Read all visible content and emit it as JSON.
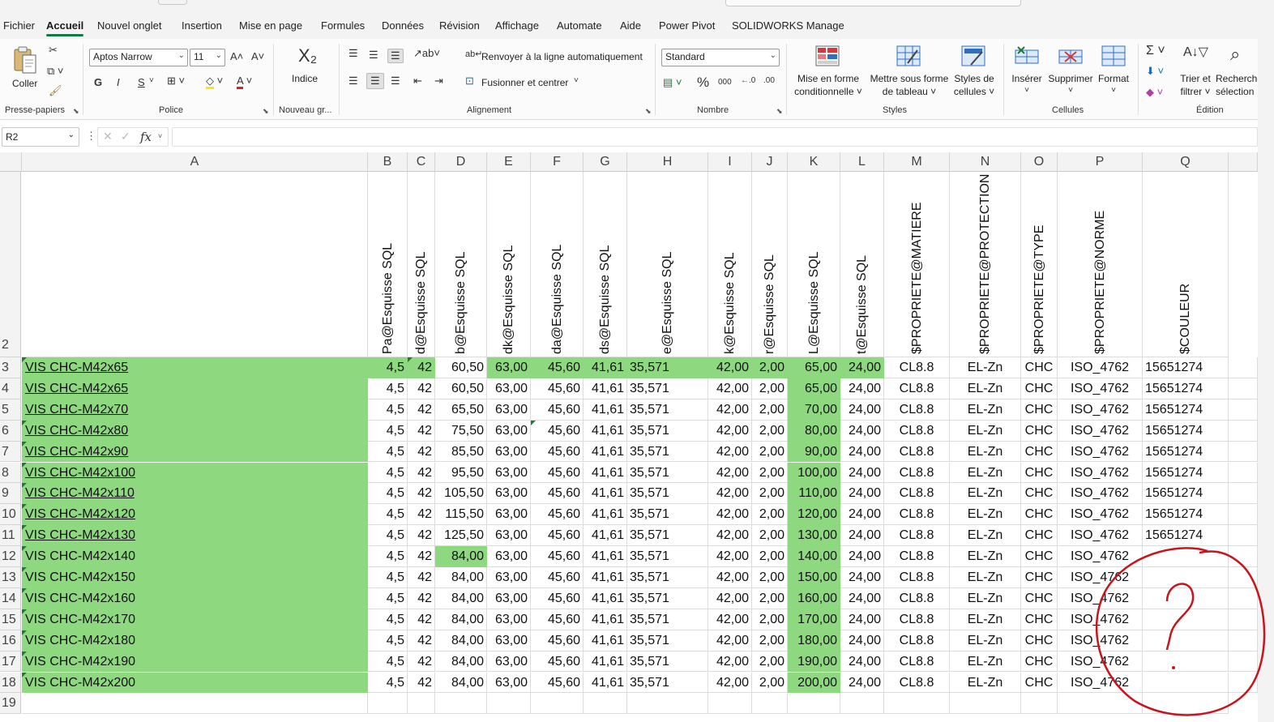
{
  "menu": {
    "tabs": [
      "Fichier",
      "Accueil",
      "Nouvel onglet",
      "Insertion",
      "Mise en page",
      "Formules",
      "Données",
      "Révision",
      "Affichage",
      "Automate",
      "Aide",
      "Power Pivot",
      "SOLIDWORKS Manage"
    ],
    "active": "Accueil"
  },
  "ribbon": {
    "clipboard": {
      "paste_label": "Coller",
      "group_label": "Presse-papiers"
    },
    "font": {
      "name": "Aptos Narrow",
      "size": "11",
      "bold": "G",
      "italic": "I",
      "underline": "S",
      "group_label": "Police"
    },
    "subscript": {
      "icon_text": "X₂",
      "label": "Indice",
      "group_label": "Nouveau gr..."
    },
    "alignment": {
      "wrap_label": "Renvoyer à la ligne automatiquement",
      "merge_label": "Fusionner et centrer",
      "group_label": "Alignement"
    },
    "number": {
      "format": "Standard",
      "percent": "%",
      "thousands": "000",
      "group_label": "Nombre"
    },
    "styles": {
      "conditional": [
        "Mise en forme",
        "conditionnelle ˅"
      ],
      "table": [
        "Mettre sous forme",
        "de tableau ˅"
      ],
      "cell_styles": [
        "Styles de",
        "cellules ˅"
      ],
      "group_label": "Styles"
    },
    "cells": {
      "insert": "Insérer",
      "delete": "Supprimer",
      "format": "Format",
      "group_label": "Cellules"
    },
    "editing": {
      "sort": [
        "Trier et",
        "filtrer ˅"
      ],
      "find": [
        "Recherche",
        "sélection"
      ],
      "group_label": "Édition"
    }
  },
  "formula_bar": {
    "name_box": "R2",
    "fx": "fx",
    "value": ""
  },
  "sheet": {
    "columns": [
      "A",
      "B",
      "C",
      "D",
      "E",
      "F",
      "G",
      "H",
      "I",
      "J",
      "K",
      "L",
      "M",
      "N",
      "O",
      "P",
      "Q"
    ],
    "row_numbers": [
      "2",
      "3",
      "4",
      "5",
      "6",
      "7",
      "8",
      "9",
      "10",
      "11",
      "12",
      "13",
      "14",
      "15",
      "16",
      "17",
      "18",
      "19"
    ],
    "headers": [
      "",
      "Pa@Esquisse SQL",
      "d@Esquisse SQL",
      "b@Esquisse SQL",
      "dk@Esquisse SQL",
      "da@Esquisse SQL",
      "ds@Esquisse SQL",
      "e@Esquisse SQL",
      "k@Esquisse SQL",
      "r@Esquisse SQL",
      "L@Esquisse SQL",
      "t@Esquisse SQL",
      "$PROPRIETE@MATIERE",
      "$PROPRIETE@PROTECTION",
      "$PROPRIETE@TYPE",
      "$PROPRIETE@NORME",
      "$COULEUR"
    ],
    "rows": [
      [
        "VIS CHC-M42x65",
        "4,5",
        "42",
        "60,50",
        "63,00",
        "45,60",
        "41,61",
        "35,571",
        "42,00",
        "2,00",
        "65,00",
        "24,00",
        "CL8.8",
        "EL-Zn",
        "CHC",
        "ISO_4762",
        "15651274"
      ],
      [
        "VIS CHC-M42x65",
        "4,5",
        "42",
        "60,50",
        "63,00",
        "45,60",
        "41,61",
        "35,571",
        "42,00",
        "2,00",
        "65,00",
        "24,00",
        "CL8.8",
        "EL-Zn",
        "CHC",
        "ISO_4762",
        "15651274"
      ],
      [
        "VIS CHC-M42x70",
        "4,5",
        "42",
        "65,50",
        "63,00",
        "45,60",
        "41,61",
        "35,571",
        "42,00",
        "2,00",
        "70,00",
        "24,00",
        "CL8.8",
        "EL-Zn",
        "CHC",
        "ISO_4762",
        "15651274"
      ],
      [
        "VIS CHC-M42x80",
        "4,5",
        "42",
        "75,50",
        "63,00",
        "45,60",
        "41,61",
        "35,571",
        "42,00",
        "2,00",
        "80,00",
        "24,00",
        "CL8.8",
        "EL-Zn",
        "CHC",
        "ISO_4762",
        "15651274"
      ],
      [
        "VIS CHC-M42x90",
        "4,5",
        "42",
        "85,50",
        "63,00",
        "45,60",
        "41,61",
        "35,571",
        "42,00",
        "2,00",
        "90,00",
        "24,00",
        "CL8.8",
        "EL-Zn",
        "CHC",
        "ISO_4762",
        "15651274"
      ],
      [
        "VIS CHC-M42x100",
        "4,5",
        "42",
        "95,50",
        "63,00",
        "45,60",
        "41,61",
        "35,571",
        "42,00",
        "2,00",
        "100,00",
        "24,00",
        "CL8.8",
        "EL-Zn",
        "CHC",
        "ISO_4762",
        "15651274"
      ],
      [
        "VIS CHC-M42x110",
        "4,5",
        "42",
        "105,50",
        "63,00",
        "45,60",
        "41,61",
        "35,571",
        "42,00",
        "2,00",
        "110,00",
        "24,00",
        "CL8.8",
        "EL-Zn",
        "CHC",
        "ISO_4762",
        "15651274"
      ],
      [
        "VIS CHC-M42x120",
        "4,5",
        "42",
        "115,50",
        "63,00",
        "45,60",
        "41,61",
        "35,571",
        "42,00",
        "2,00",
        "120,00",
        "24,00",
        "CL8.8",
        "EL-Zn",
        "CHC",
        "ISO_4762",
        "15651274"
      ],
      [
        "VIS CHC-M42x130",
        "4,5",
        "42",
        "125,50",
        "63,00",
        "45,60",
        "41,61",
        "35,571",
        "42,00",
        "2,00",
        "130,00",
        "24,00",
        "CL8.8",
        "EL-Zn",
        "CHC",
        "ISO_4762",
        "15651274"
      ],
      [
        "VIS CHC-M42x140",
        "4,5",
        "42",
        "84,00",
        "63,00",
        "45,60",
        "41,61",
        "35,571",
        "42,00",
        "2,00",
        "140,00",
        "24,00",
        "CL8.8",
        "EL-Zn",
        "CHC",
        "ISO_4762",
        ""
      ],
      [
        "VIS CHC-M42x150",
        "4,5",
        "42",
        "84,00",
        "63,00",
        "45,60",
        "41,61",
        "35,571",
        "42,00",
        "2,00",
        "150,00",
        "24,00",
        "CL8.8",
        "EL-Zn",
        "CHC",
        "ISO_4762",
        ""
      ],
      [
        "VIS CHC-M42x160",
        "4,5",
        "42",
        "84,00",
        "63,00",
        "45,60",
        "41,61",
        "35,571",
        "42,00",
        "2,00",
        "160,00",
        "24,00",
        "CL8.8",
        "EL-Zn",
        "CHC",
        "ISO_4762",
        ""
      ],
      [
        "VIS CHC-M42x170",
        "4,5",
        "42",
        "84,00",
        "63,00",
        "45,60",
        "41,61",
        "35,571",
        "42,00",
        "2,00",
        "170,00",
        "24,00",
        "CL8.8",
        "EL-Zn",
        "CHC",
        "ISO_4762",
        ""
      ],
      [
        "VIS CHC-M42x180",
        "4,5",
        "42",
        "84,00",
        "63,00",
        "45,60",
        "41,61",
        "35,571",
        "42,00",
        "2,00",
        "180,00",
        "24,00",
        "CL8.8",
        "EL-Zn",
        "CHC",
        "ISO_4762",
        ""
      ],
      [
        "VIS CHC-M42x190",
        "4,5",
        "42",
        "84,00",
        "63,00",
        "45,60",
        "41,61",
        "35,571",
        "42,00",
        "2,00",
        "190,00",
        "24,00",
        "CL8.8",
        "EL-Zn",
        "CHC",
        "ISO_4762",
        ""
      ],
      [
        "VIS CHC-M42x200",
        "4,5",
        "42",
        "84,00",
        "63,00",
        "45,60",
        "41,61",
        "35,571",
        "42,00",
        "2,00",
        "200,00",
        "24,00",
        "CL8.8",
        "EL-Zn",
        "CHC",
        "ISO_4762",
        ""
      ]
    ],
    "highlight_color": "#8ed97f",
    "annotation": {
      "text": "?",
      "color": "#c8141c"
    }
  }
}
